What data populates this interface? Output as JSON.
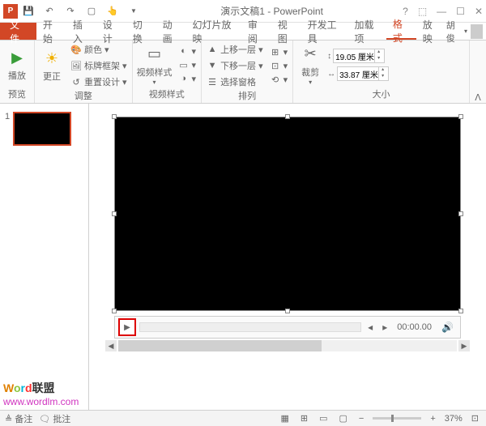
{
  "title": "演示文稿1 - PowerPoint",
  "qat": {
    "save": "save",
    "undo": "undo",
    "redo": "redo",
    "start": "start",
    "touch": "touch"
  },
  "tabs": {
    "file": "文件",
    "items": [
      "开始",
      "插入",
      "设计",
      "切换",
      "动画",
      "幻灯片放映",
      "审阅",
      "视图",
      "开发工具",
      "加载项",
      "格式",
      "放映"
    ],
    "active_index": 10,
    "user": "胡俊"
  },
  "ribbon": {
    "preview": {
      "play": "播放",
      "label": "预览"
    },
    "adjust": {
      "corrections": "更正",
      "color": "颜色",
      "poster": "标牌框架",
      "reset": "重置设计",
      "label": "调整"
    },
    "video_styles": {
      "styles_btn": "视频样式",
      "label": "视频样式"
    },
    "arrange": {
      "front": "上移一层",
      "back": "下移一层",
      "pane": "选择窗格",
      "label": "排列"
    },
    "size": {
      "crop": "裁剪",
      "height": "19.05 厘米",
      "width": "33.87 厘米",
      "label": "大小"
    }
  },
  "slide": {
    "num": "1"
  },
  "video_controls": {
    "time": "00:00.00"
  },
  "status": {
    "notes": "备注",
    "comments": "批注",
    "zoom": "37%"
  },
  "watermark": {
    "brand": "Word联盟",
    "url": "www.wordlm.com"
  }
}
